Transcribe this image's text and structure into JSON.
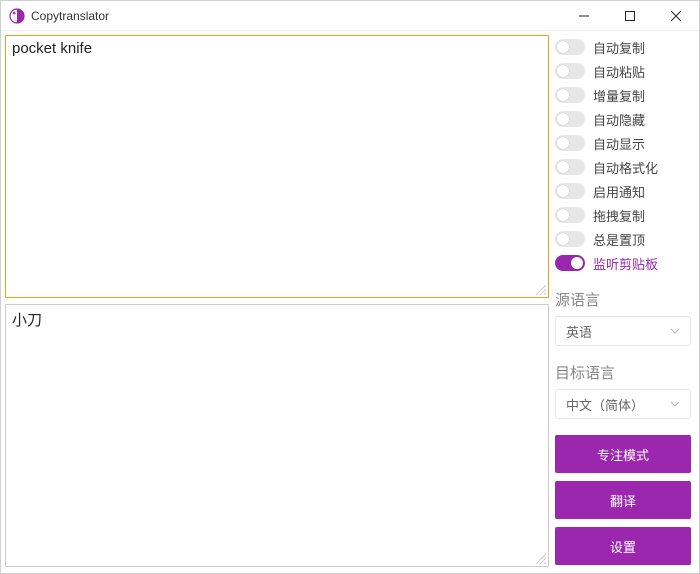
{
  "title": "Copytranslator",
  "colors": {
    "accent": "#9b27af",
    "sourceBorder": "#f0a020"
  },
  "source": {
    "value": "pocket knife"
  },
  "target": {
    "value": "小刀"
  },
  "toggles": [
    {
      "label": "自动复制",
      "on": false
    },
    {
      "label": "自动粘贴",
      "on": false
    },
    {
      "label": "增量复制",
      "on": false
    },
    {
      "label": "自动隐藏",
      "on": false
    },
    {
      "label": "自动显示",
      "on": false
    },
    {
      "label": "自动格式化",
      "on": false
    },
    {
      "label": "启用通知",
      "on": false
    },
    {
      "label": "拖拽复制",
      "on": false
    },
    {
      "label": "总是置顶",
      "on": false
    },
    {
      "label": "监听剪贴板",
      "on": true
    }
  ],
  "sections": {
    "sourceLang": "源语言",
    "targetLang": "目标语言"
  },
  "selects": {
    "sourceLang": "英语",
    "targetLang": "中文（简体）"
  },
  "buttons": {
    "focus": "专注模式",
    "translate": "翻译",
    "settings": "设置"
  }
}
